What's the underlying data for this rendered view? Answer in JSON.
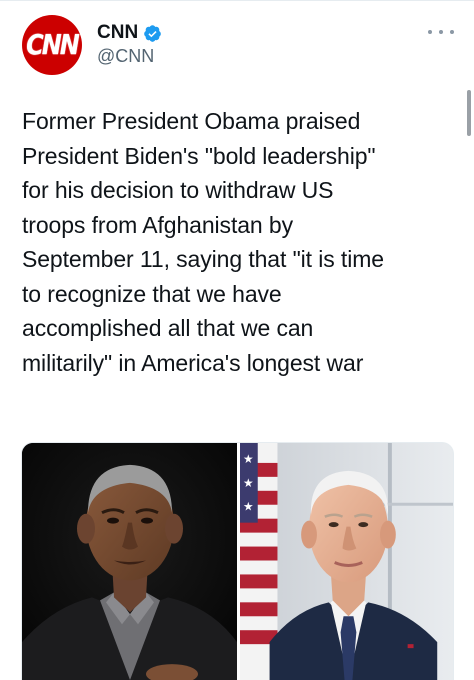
{
  "account": {
    "display_name": "CNN",
    "handle": "@CNN",
    "avatar_text": "CNN",
    "verified": true
  },
  "tweet": {
    "lines": [
      "Former President Obama praised",
      "President Biden's \"bold leadership\"",
      "for his decision to withdraw US",
      "troops from Afghanistan by",
      "September 11, saying that \"it is time",
      "to recognize that we have",
      "accomplished all that we can",
      "militarily\" in America's longest war"
    ]
  },
  "media": {
    "images": [
      {
        "name": "obama-photo"
      },
      {
        "name": "biden-photo"
      }
    ]
  },
  "icons": {
    "verified": "verified-badge-icon",
    "more": "more-options-icon"
  },
  "colors": {
    "brand_red": "#cc0000",
    "verified_blue": "#1d9bf0",
    "text": "#0f1419",
    "secondary_text": "#536471"
  }
}
